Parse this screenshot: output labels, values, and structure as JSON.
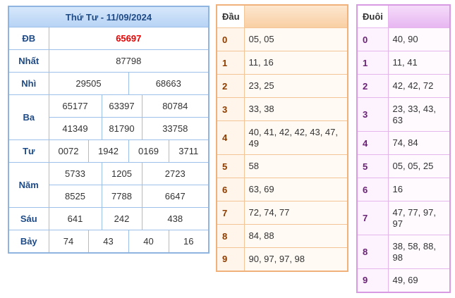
{
  "kqxs": {
    "title": "Thứ Tư - 11/09/2024",
    "rows": {
      "db": {
        "label": "ĐB",
        "values": [
          "65697"
        ]
      },
      "nhat": {
        "label": "Nhất",
        "values": [
          "87798"
        ]
      },
      "nhi": {
        "label": "Nhì",
        "values": [
          "29505",
          "68663"
        ]
      },
      "ba": {
        "label": "Ba",
        "values": [
          "65177",
          "63397",
          "80784",
          "41349",
          "81790",
          "33758"
        ]
      },
      "tu": {
        "label": "Tư",
        "values": [
          "0072",
          "1942",
          "0169",
          "3711"
        ]
      },
      "nam": {
        "label": "Năm",
        "values": [
          "5733",
          "1205",
          "2723",
          "8525",
          "7788",
          "6647"
        ]
      },
      "sau": {
        "label": "Sáu",
        "values": [
          "641",
          "242",
          "438"
        ]
      },
      "bay": {
        "label": "Bảy",
        "values": [
          "74",
          "43",
          "40",
          "16"
        ]
      }
    }
  },
  "dau": {
    "header": "Đầu",
    "rows": [
      {
        "key": "0",
        "values": "05, 05"
      },
      {
        "key": "1",
        "values": "11, 16"
      },
      {
        "key": "2",
        "values": "23, 25"
      },
      {
        "key": "3",
        "values": "33, 38"
      },
      {
        "key": "4",
        "values": "40, 41, 42, 42, 43, 47, 49"
      },
      {
        "key": "5",
        "values": "58"
      },
      {
        "key": "6",
        "values": "63, 69"
      },
      {
        "key": "7",
        "values": "72, 74, 77"
      },
      {
        "key": "8",
        "values": "84, 88"
      },
      {
        "key": "9",
        "values": "90, 97, 97, 98"
      }
    ]
  },
  "duoi": {
    "header": "Đuôi",
    "rows": [
      {
        "key": "0",
        "values": "40, 90"
      },
      {
        "key": "1",
        "values": "11, 41"
      },
      {
        "key": "2",
        "values": "42, 42, 72"
      },
      {
        "key": "3",
        "values": "23, 33, 43, 63"
      },
      {
        "key": "4",
        "values": "74, 84"
      },
      {
        "key": "5",
        "values": "05, 05, 25"
      },
      {
        "key": "6",
        "values": "16"
      },
      {
        "key": "7",
        "values": "47, 77, 97, 97"
      },
      {
        "key": "8",
        "values": "38, 58, 88, 98"
      },
      {
        "key": "9",
        "values": "49, 69"
      }
    ]
  },
  "colors": {
    "main_border": "#8fb4e0",
    "main_header": "#b7d3f5",
    "special_prize": "#e60000",
    "dau_border": "#f0b17a",
    "duoi_border": "#d79ae3"
  }
}
